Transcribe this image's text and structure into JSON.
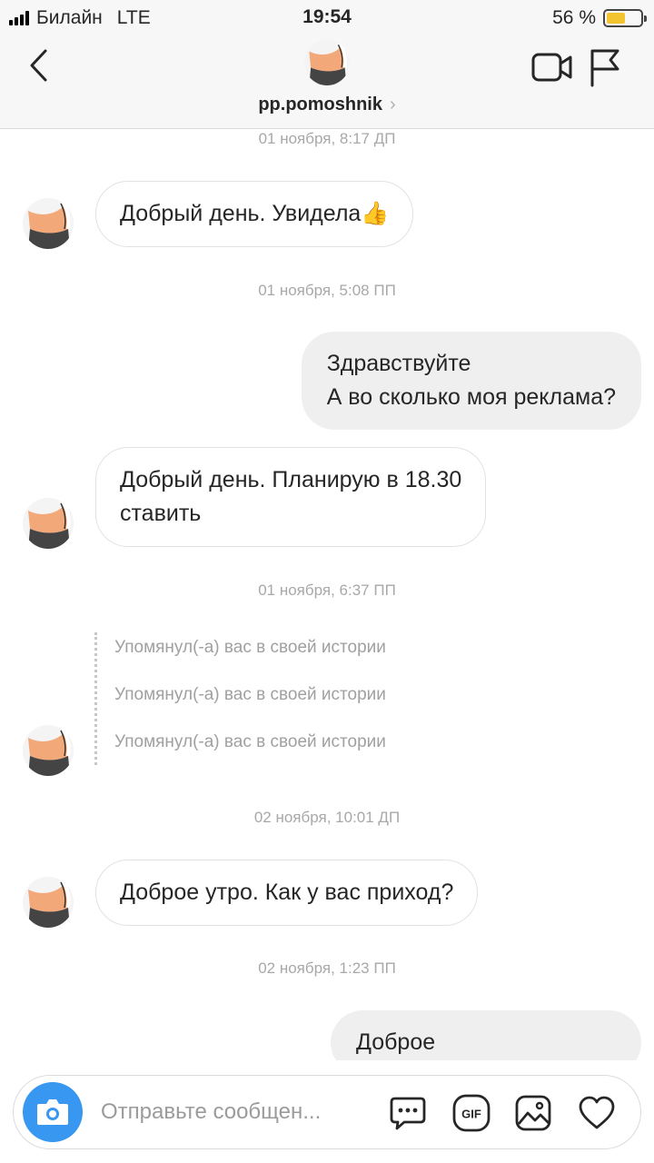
{
  "status_bar": {
    "carrier": "Билайн",
    "network": "LTE",
    "time": "19:54",
    "battery_text": "56 %",
    "battery_level": 0.56,
    "battery_color": "#f2c530"
  },
  "header": {
    "username": "pp.pomoshnik",
    "chevron": "›",
    "back_icon": "chevron-left-icon",
    "video_icon": "video-camera-icon",
    "flag_icon": "flag-icon"
  },
  "messages": [
    {
      "type": "timestamp",
      "text": "01 ноября, 8:17 ДП"
    },
    {
      "type": "incoming",
      "text": "Добрый день. Увидела👍"
    },
    {
      "type": "timestamp",
      "text": "01 ноября, 5:08 ПП"
    },
    {
      "type": "outgoing",
      "lines": [
        "Здравствуйте",
        "А во сколько моя реклама?"
      ]
    },
    {
      "type": "incoming",
      "lines": [
        "Добрый день. Планирую в 18.30",
        "ставить"
      ]
    },
    {
      "type": "timestamp",
      "text": "01 ноября, 6:37 ПП"
    },
    {
      "type": "mentions",
      "items": [
        "Упомянул(-а) вас в своей истории",
        "Упомянул(-а) вас в своей истории",
        "Упомянул(-а) вас в своей истории"
      ]
    },
    {
      "type": "timestamp",
      "text": "02 ноября, 10:01 ДП"
    },
    {
      "type": "incoming",
      "text": "Доброе утро. Как у вас приход?"
    },
    {
      "type": "timestamp",
      "text": "02 ноября, 1:23 ПП"
    },
    {
      "type": "outgoing",
      "text": "Доброе"
    }
  ],
  "composer": {
    "placeholder": "Отправьте сообщен...",
    "camera_color": "#3897f0",
    "icons": [
      "chat-bubble-icon",
      "gif-icon",
      "gallery-icon",
      "heart-icon"
    ],
    "gif_label": "GIF"
  }
}
